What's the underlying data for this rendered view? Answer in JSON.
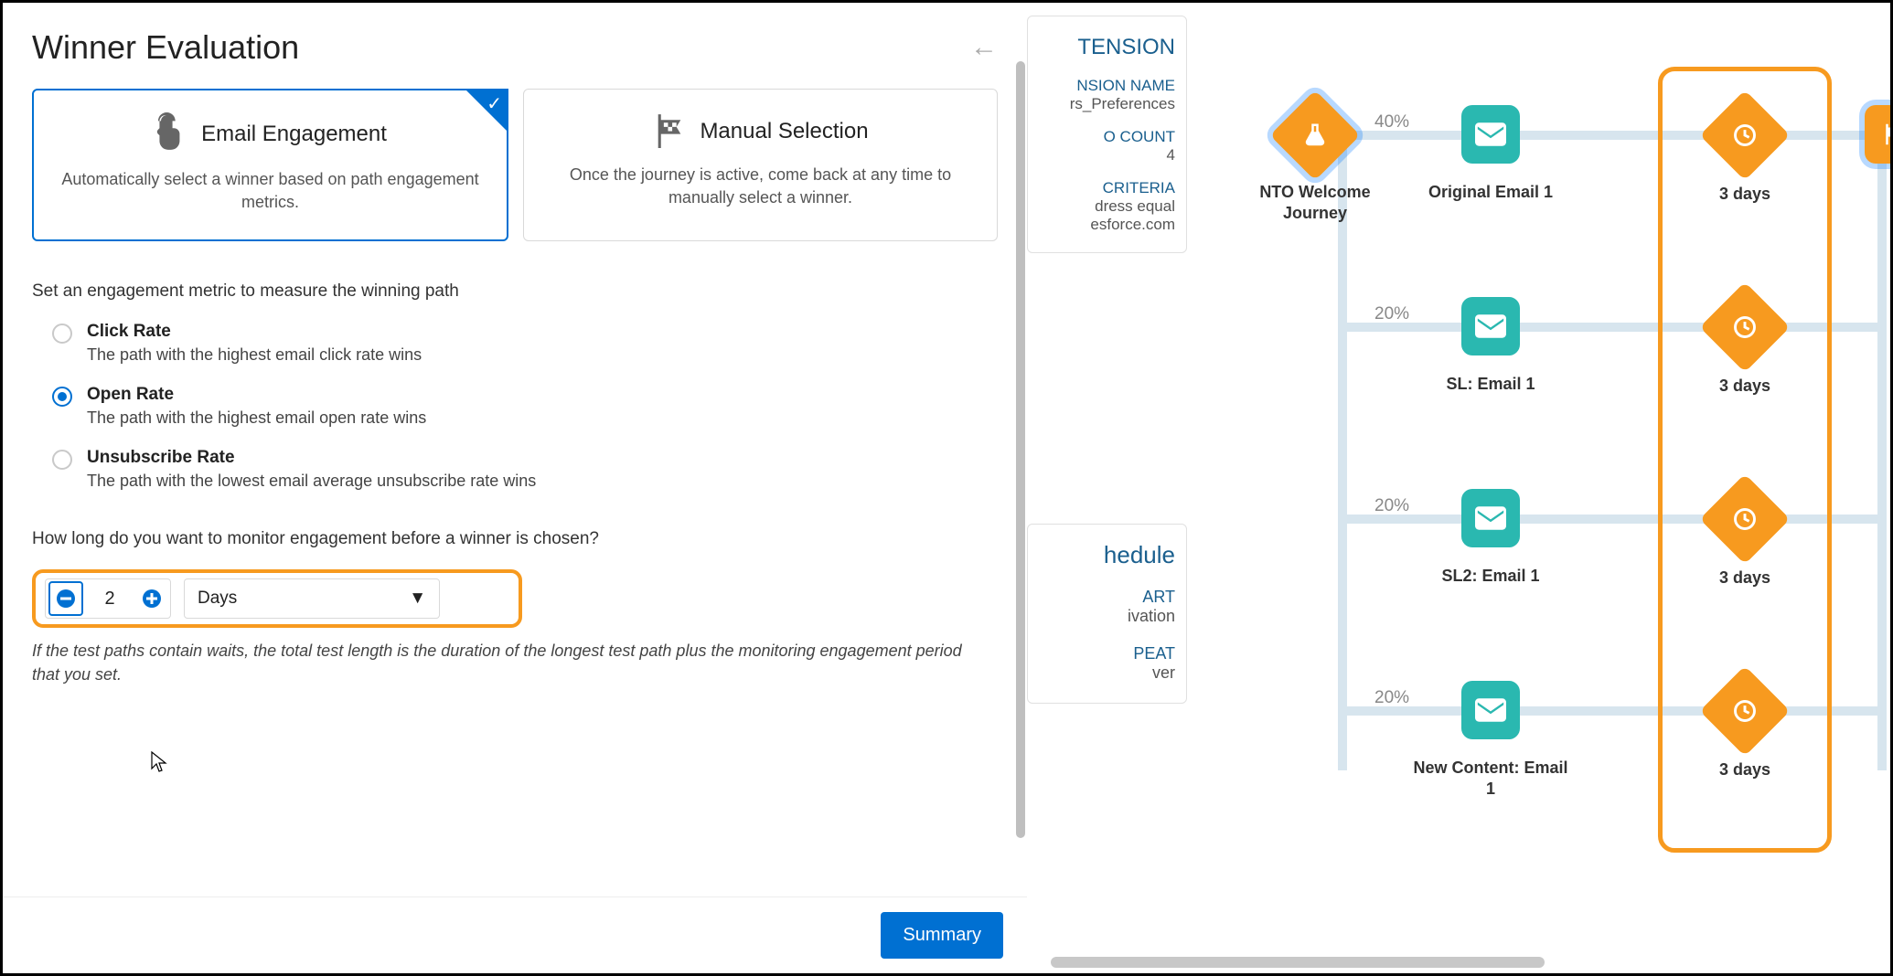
{
  "panel": {
    "title": "Winner Evaluation",
    "options": [
      {
        "title": "Email Engagement",
        "desc": "Automatically select a winner based on path engagement metrics.",
        "selected": true
      },
      {
        "title": "Manual Selection",
        "desc": "Once the journey is active, come back at any time to manually select a winner.",
        "selected": false
      }
    ],
    "metric_label": "Set an engagement metric to measure the winning path",
    "metrics": [
      {
        "title": "Click Rate",
        "desc": "The path with the highest email click rate wins",
        "checked": false
      },
      {
        "title": "Open Rate",
        "desc": "The path with the highest email open rate wins",
        "checked": true
      },
      {
        "title": "Unsubscribe Rate",
        "desc": "The path with the lowest email average unsubscribe rate wins",
        "checked": false
      }
    ],
    "duration_label": "How long do you want to monitor engagement before a winner is chosen?",
    "duration_value": "2",
    "duration_unit": "Days",
    "note": "If the test paths contain waits, the total test length is the duration of the longest test path plus the monitoring engagement period that you set.",
    "summary_btn": "Summary"
  },
  "bg": {
    "de_header": "TENSION",
    "de_name_lbl": "NSION NAME",
    "de_name_val": "rs_Preferences",
    "de_count_lbl": "O COUNT",
    "de_count_val": "4",
    "de_crit_lbl": "CRITERIA",
    "de_crit_val1": "dress equal",
    "de_crit_val2": "esforce.com",
    "sched_header": "hedule",
    "sched_lbl1": "ART",
    "sched_val1": "ivation",
    "sched_lbl2": "PEAT",
    "sched_val2": "ver"
  },
  "journey": {
    "start_label": "NTO Welcome Journey",
    "paths": [
      {
        "pct": "40%",
        "email": "Original Email 1",
        "wait": "3 days"
      },
      {
        "pct": "20%",
        "email": "SL: Email 1",
        "wait": "3 days"
      },
      {
        "pct": "20%",
        "email": "SL2: Email 1",
        "wait": "3 days"
      },
      {
        "pct": "20%",
        "email": "New Content: Email 1",
        "wait": "3 days"
      }
    ]
  }
}
